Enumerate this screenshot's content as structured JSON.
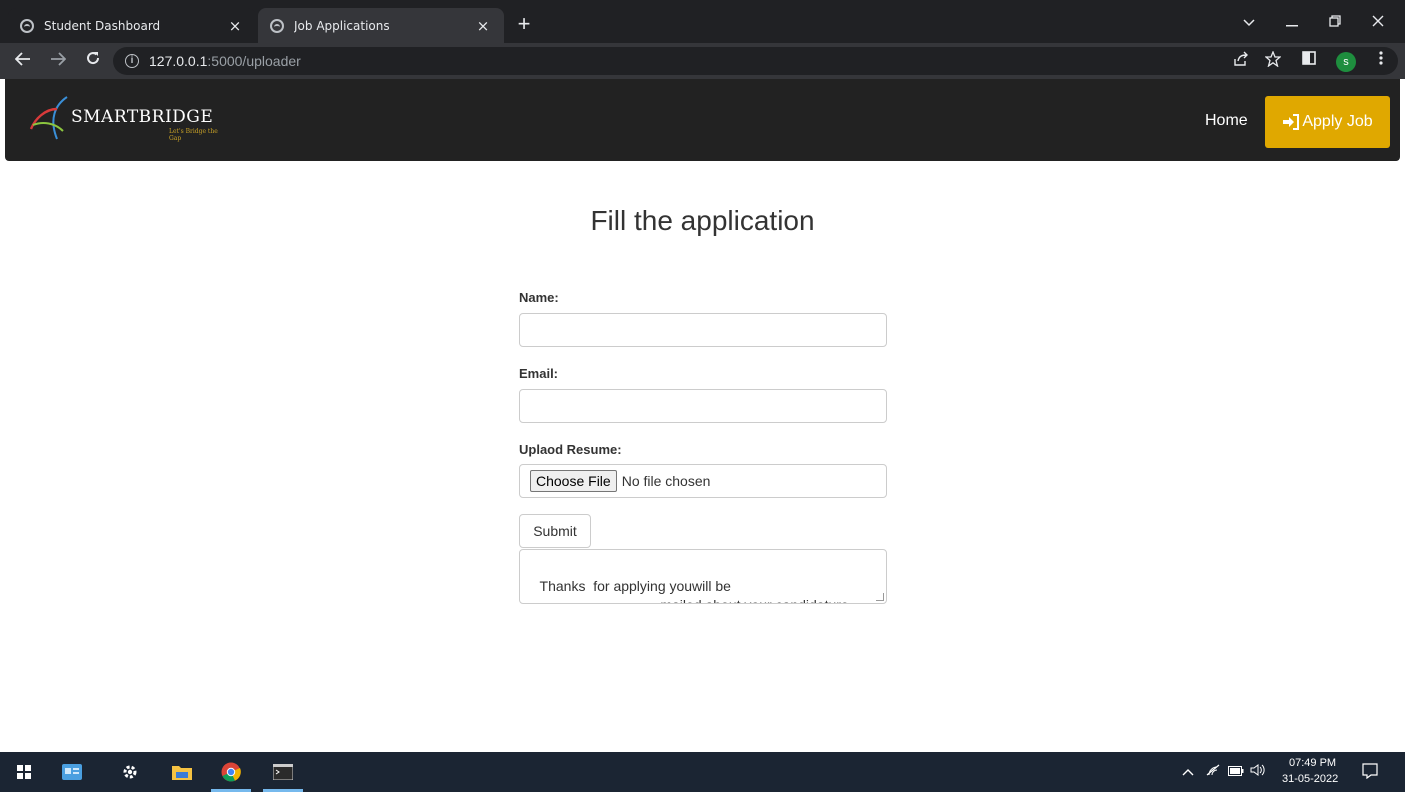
{
  "browser": {
    "tabs": [
      {
        "title": "Student Dashboard",
        "close": "×"
      },
      {
        "title": "Job Applications",
        "close": "×"
      }
    ],
    "new_tab": "+",
    "url_host": "127.0.0.1",
    "url_path": ":5000/uploader",
    "profile_initial": "s",
    "icons": [
      "back-arrow-icon",
      "forward-arrow-icon",
      "reload-icon",
      "info-icon",
      "share-icon",
      "star-icon",
      "side-panel-icon",
      "menu-dots-icon"
    ]
  },
  "navbar": {
    "brand_name": "SMARTBRIDGE",
    "brand_tagline": "Let's Bridge the Gap",
    "home_label": "Home",
    "apply_label": "Apply Job",
    "colors": {
      "background": "#222222",
      "accent": "#e0a800"
    }
  },
  "form": {
    "title": "Fill the application",
    "name_label": "Name:",
    "name_value": "",
    "email_label": "Email:",
    "email_value": "",
    "resume_label": "Uplaod Resume:",
    "choose_file_label": "Choose File",
    "no_file_text": "No file chosen",
    "submit_label": "Submit",
    "message_text": "Thanks  for applying youwill be \n                                 mailed about your candidature"
  },
  "taskbar": {
    "apps": [
      "windows-start-icon",
      "news-icon",
      "settings-gear-icon",
      "file-explorer-icon",
      "chrome-icon",
      "terminal-icon"
    ],
    "time": "07:49 PM",
    "date": "31-05-2022"
  }
}
